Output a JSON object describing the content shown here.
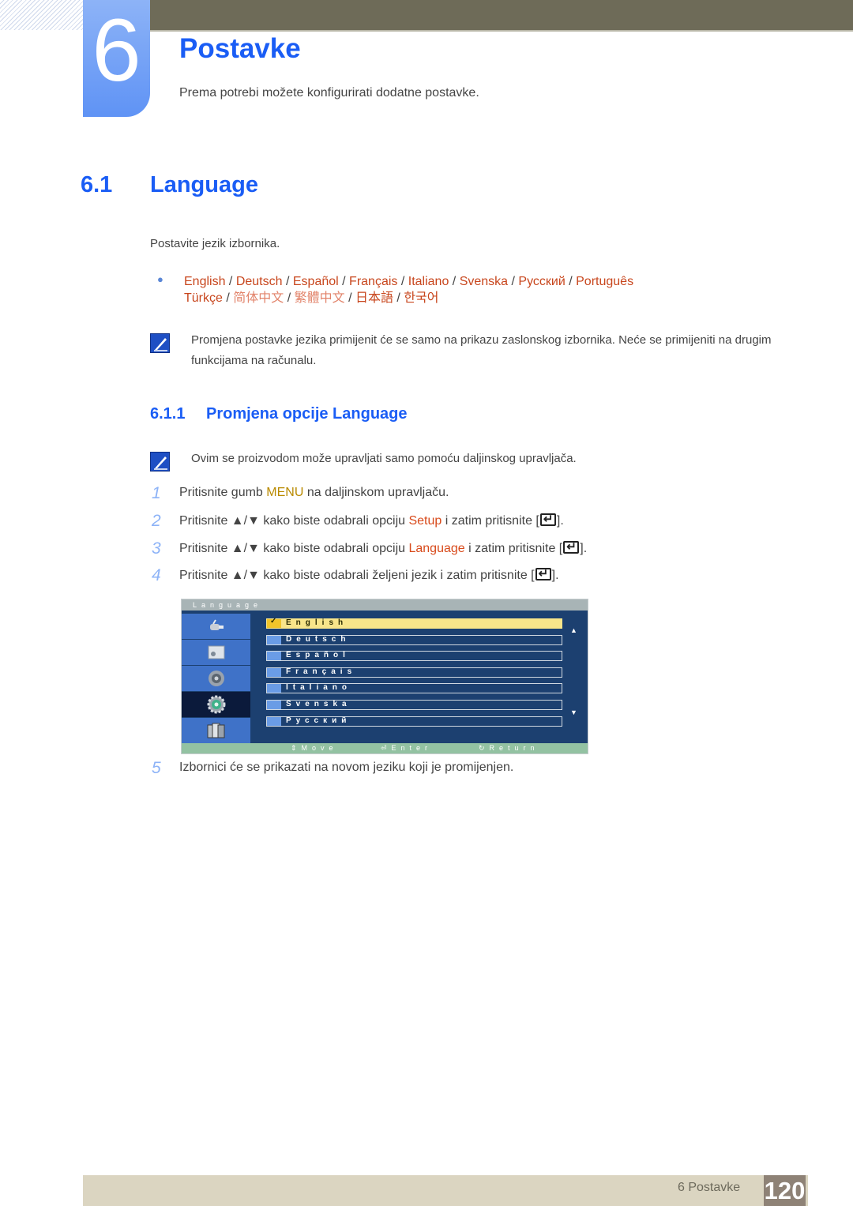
{
  "chapter": {
    "number": "6",
    "title": "Postavke",
    "subtitle": "Prema potrebi možete konfigurirati dodatne postavke."
  },
  "section": {
    "number": "6.1",
    "title": "Language",
    "intro": "Postavite jezik izbornika.",
    "languages_line1": [
      "English",
      "Deutsch",
      "Español",
      "Français",
      "Italiano",
      "Svenska",
      "Русский",
      "Português"
    ],
    "languages_line2": [
      "Türkçe",
      "简体中文",
      "繁體中文",
      "日本語",
      "한국어"
    ],
    "separator": " / ",
    "note": "Promjena postavke jezika primijenit će se samo na prikazu zaslonskog izbornika. Neće se primijeniti na drugim funkcijama na računalu."
  },
  "subsection": {
    "number": "6.1.1",
    "title": "Promjena opcije Language",
    "note": "Ovim se proizvodom može upravljati samo pomoću daljinskog upravljača.",
    "steps": [
      {
        "num": "1",
        "pre": "Pritisnite gumb ",
        "keyword": "MENU",
        "post": " na daljinskom upravljaču."
      },
      {
        "num": "2",
        "pre": "Pritisnite ▲/▼ kako biste odabrali opciju ",
        "keyword": "Setup",
        "post": " i zatim pritisnite [",
        "end": "]."
      },
      {
        "num": "3",
        "pre": "Pritisnite ▲/▼ kako biste odabrali opciju ",
        "keyword": "Language",
        "post": " i zatim pritisnite [",
        "end": "]."
      },
      {
        "num": "4",
        "pre": "Pritisnite ▲/▼ kako biste odabrali željeni jezik i zatim pritisnite [",
        "end": "]."
      },
      {
        "num": "5",
        "pre": "Izbornici će se prikazati na novom jeziku koji je promijenjen."
      }
    ]
  },
  "osd": {
    "title": "Language",
    "side_icons": [
      "input-icon",
      "picture-icon",
      "sound-icon",
      "setup-icon",
      "multi-window-icon"
    ],
    "active_side_index": 3,
    "options": [
      "English",
      "Deutsch",
      "Español",
      "Français",
      "Italiano",
      "Svenska",
      "Русский"
    ],
    "selected_option": "English",
    "check_mark": "✓",
    "footer": {
      "move": "Move",
      "enter": "Enter",
      "return": "Return"
    }
  },
  "footer": {
    "chapter_label": "6 Postavke",
    "page_number": "120"
  },
  "colors": {
    "accent_blue": "#1a5df5",
    "keyword_orange": "#d84a1b",
    "menu_gold": "#b98a00"
  }
}
